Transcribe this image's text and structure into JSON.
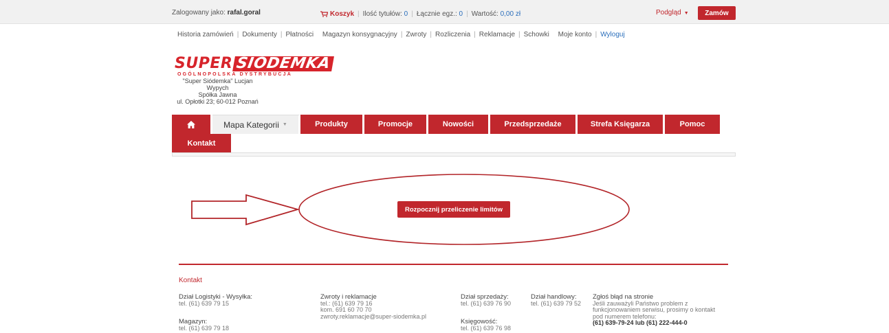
{
  "topbar": {
    "logged_label": "Zalogowany jako:",
    "username": "rafal.goral",
    "cart_label": "Koszyk",
    "titles_label": "Ilość tytułów:",
    "titles_value": "0",
    "copies_label": "Łącznie egz.:",
    "copies_value": "0",
    "value_label": "Wartość:",
    "value_amount": "0,00 zł",
    "preview_label": "Podgląd",
    "order_button": "Zamów"
  },
  "subnav": {
    "items": [
      "Historia zamówień",
      "Dokumenty",
      "Płatności",
      "Magazyn konsygnacyjny",
      "Zwroty",
      "Rozliczenia",
      "Reklamacje",
      "Schowki",
      "Moje konto"
    ],
    "logout": "Wyloguj"
  },
  "logo": {
    "part1": "SUPER",
    "part2": "SIÓDEMKA",
    "tagline": "OGÓLNOPOLSKA DYSTRYBUCJA"
  },
  "company": {
    "line1": "\"Super Siódemka\" Lucjan Wypych",
    "line2": "Spółka Jawna",
    "line3": "ul. Opłotki 23; 60-012 Poznań"
  },
  "menu": {
    "mapa": "Mapa Kategorii",
    "tabs": [
      "Produkty",
      "Promocje",
      "Nowości",
      "Przedsprzedaże",
      "Strefa Księgarza",
      "Pomoc"
    ],
    "kontakt": "Kontakt"
  },
  "main": {
    "recalc_button": "Rozpocznij przeliczenie limitów"
  },
  "footer": {
    "title": "Kontakt",
    "logistyka_h": "Dział Logistyki - Wysyłka:",
    "logistyka_tel": "tel. (61) 639 79 15",
    "magazyn_h": "Magazyn:",
    "magazyn_tel": "tel. (61) 639 79 18",
    "zwroty_h": "Zwroty i reklamacje",
    "zwroty_tel": "tel.: (61) 639 79 16",
    "zwroty_kom": "kom. 691 60 70 70",
    "zwroty_email": "zwroty.reklamacje@super-siodemka.pl",
    "sprzedaz_h": "Dział sprzedaży:",
    "sprzedaz_tel": "tel. (61) 639 76 90",
    "ksiegowosc_h": "Księgowość:",
    "ksiegowosc_tel": "tel. (61) 639 76 98",
    "handlowy_h": "Dział handlowy:",
    "handlowy_tel": "tel. (61) 639 79 52",
    "blad_h": "Zgłoś błąd na stronie",
    "blad_l1": "Jeśli zauważyli Państwo problem z",
    "blad_l2": "funkcjonowaniem serwisu, prosimy o kontakt",
    "blad_l3": "pod numerem telefonu:",
    "blad_phone": "(61) 639-79-24 lub (61) 222-444-0"
  },
  "colors": {
    "brand_red": "#c1272d",
    "link_blue": "#2a6ebb"
  }
}
